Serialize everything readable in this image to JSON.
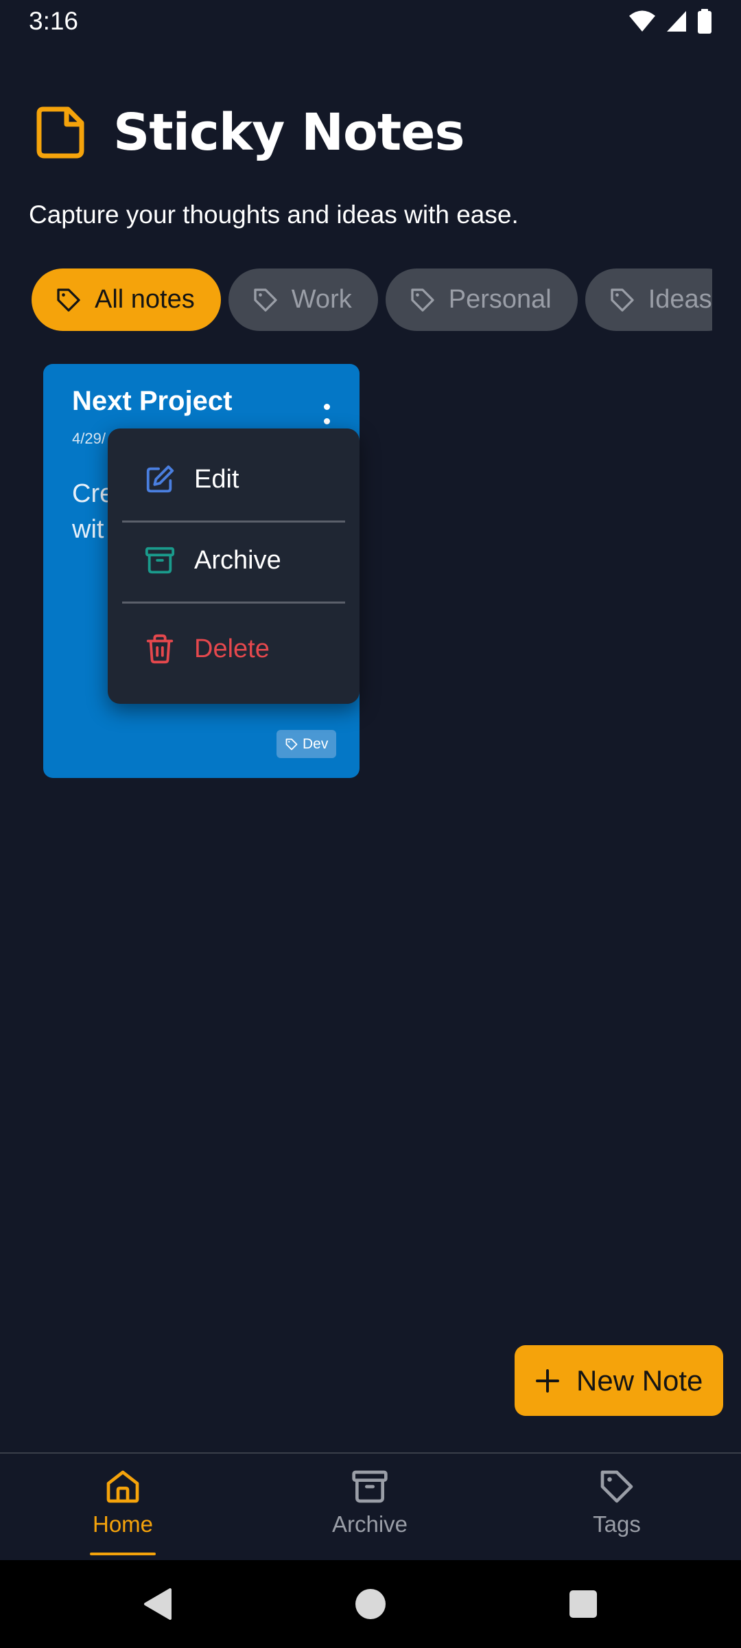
{
  "status_bar": {
    "time": "3:16"
  },
  "header": {
    "title": "Sticky Notes",
    "subtitle": "Capture your thoughts and ideas with ease."
  },
  "chips": [
    {
      "label": "All notes",
      "active": true
    },
    {
      "label": "Work",
      "active": false
    },
    {
      "label": "Personal",
      "active": false
    },
    {
      "label": "Ideas",
      "active": false
    }
  ],
  "note": {
    "title": "Next Project",
    "date": "4/29/",
    "body_line1": "Cre",
    "body_line2": "wit",
    "tag": "Dev",
    "color": "#0477c6"
  },
  "menu": {
    "edit": "Edit",
    "archive": "Archive",
    "delete": "Delete"
  },
  "fab": {
    "label": "New Note"
  },
  "bottom_nav": {
    "home": "Home",
    "archive": "Archive",
    "tags": "Tags"
  },
  "colors": {
    "accent": "#f5a30b",
    "background": "#131827",
    "menu_bg": "#1f2633",
    "edit_icon": "#4a7fe0",
    "archive_icon": "#1a9b8c",
    "delete": "#e5484d"
  }
}
